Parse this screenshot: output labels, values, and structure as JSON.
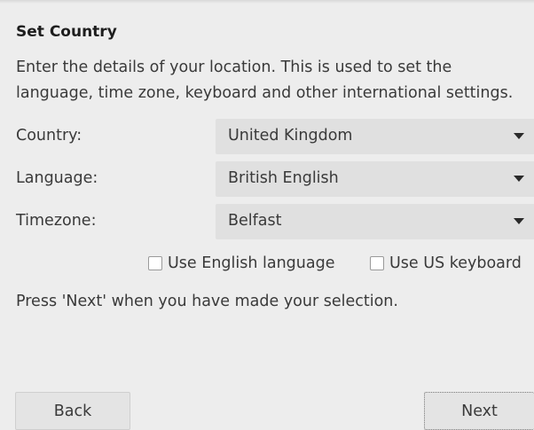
{
  "dialog": {
    "title": "Set Country",
    "description_line1": "Enter the details of your location. This is used to set the",
    "description_line2": "language, time zone, keyboard and other international settings.",
    "hint": "Press 'Next' when you have made your selection."
  },
  "fields": {
    "country": {
      "label": "Country:",
      "value": "United Kingdom"
    },
    "language": {
      "label": "Language:",
      "value": "British English"
    },
    "timezone": {
      "label": "Timezone:",
      "value": "Belfast"
    }
  },
  "options": {
    "use_english": {
      "label": "Use English language",
      "checked": false
    },
    "use_us_keyboard": {
      "label": "Use US keyboard",
      "checked": false
    }
  },
  "buttons": {
    "back": "Back",
    "next": "Next"
  },
  "icons": {
    "dropdown": "chevron-down-icon"
  }
}
